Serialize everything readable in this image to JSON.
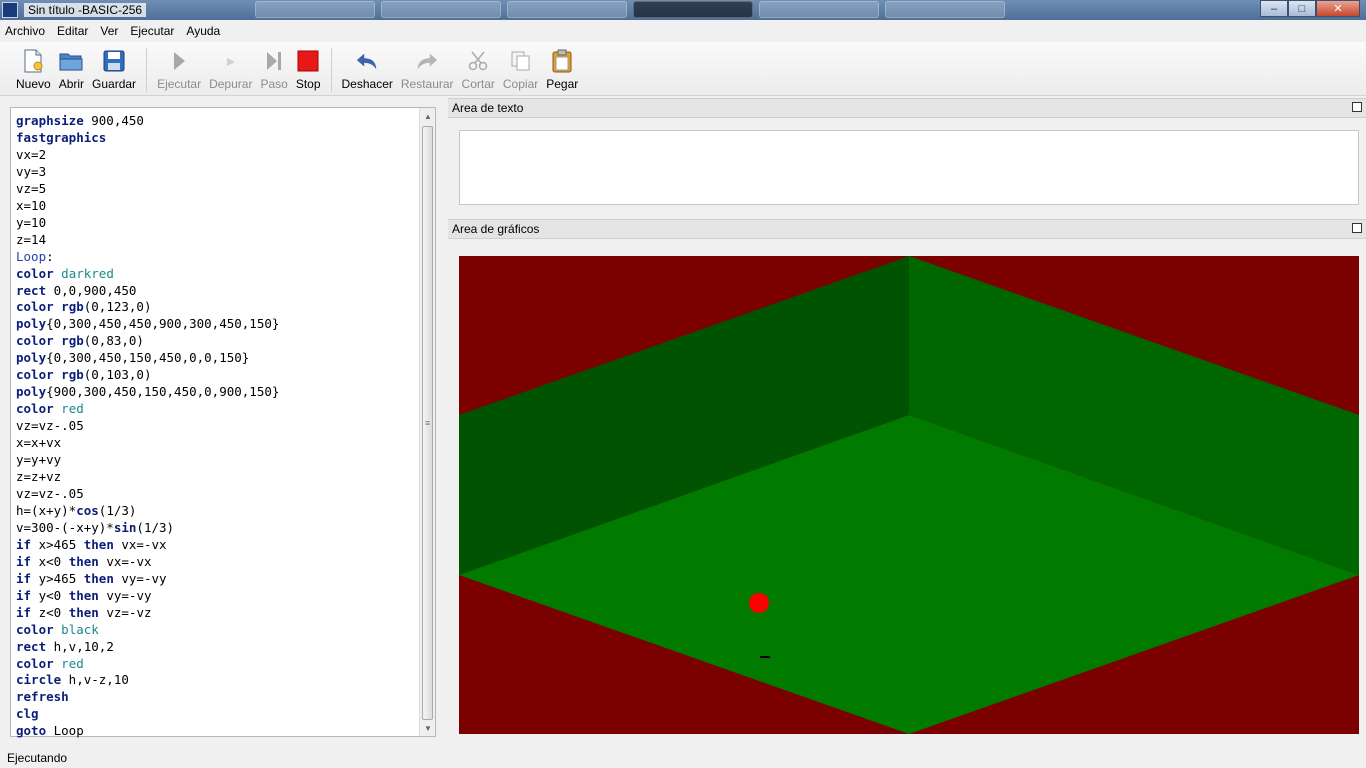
{
  "window": {
    "title": "Sin título -BASIC-256",
    "buttons": {
      "minimize": "–",
      "maximize": "□",
      "close": "✕"
    }
  },
  "menu": {
    "items": [
      "Archivo",
      "Editar",
      "Ver",
      "Ejecutar",
      "Ayuda"
    ]
  },
  "toolbar": {
    "buttons": [
      {
        "label": "Nuevo",
        "icon": "new-file-icon",
        "enabled": true
      },
      {
        "label": "Abrir",
        "icon": "open-folder-icon",
        "enabled": true
      },
      {
        "label": "Guardar",
        "icon": "save-disk-icon",
        "enabled": true
      },
      {
        "label": "Ejecutar",
        "icon": "run-icon",
        "enabled": false
      },
      {
        "label": "Depurar",
        "icon": "debug-icon",
        "enabled": false
      },
      {
        "label": "Paso",
        "icon": "step-icon",
        "enabled": false
      },
      {
        "label": "Stop",
        "icon": "stop-icon",
        "enabled": true
      },
      {
        "label": "Deshacer",
        "icon": "undo-icon",
        "enabled": true
      },
      {
        "label": "Restaurar",
        "icon": "redo-icon",
        "enabled": false
      },
      {
        "label": "Cortar",
        "icon": "scissors-icon",
        "enabled": false
      },
      {
        "label": "Copiar",
        "icon": "copy-icon",
        "enabled": false
      },
      {
        "label": "Pegar",
        "icon": "paste-clipboard-icon",
        "enabled": true
      }
    ]
  },
  "editor": {
    "lines": [
      "graphsize 900,450",
      "fastgraphics",
      "vx=2",
      "vy=3",
      "vz=5",
      "x=10",
      "y=10",
      "z=14",
      "Loop:",
      "color darkred",
      "rect 0,0,900,450",
      "color rgb(0,123,0)",
      "poly{0,300,450,450,900,300,450,150}",
      "color rgb(0,83,0)",
      "poly{0,300,450,150,450,0,0,150}",
      "color rgb(0,103,0)",
      "poly{900,300,450,150,450,0,900,150}",
      "color red",
      "vz=vz-.05",
      "x=x+vx",
      "y=y+vy",
      "z=z+vz",
      "vz=vz-.05",
      "h=(x+y)*cos(1/3)",
      "v=300-(-x+y)*sin(1/3)",
      "if x>465 then vx=-vx",
      "if x<0 then vx=-vx",
      "if y>465 then vy=-vy",
      "if y<0 then vy=-vy",
      "if z<0 then vz=-vz",
      "color black",
      "rect h,v,10,2",
      "color red",
      "circle h,v-z,10",
      "refresh",
      "clg",
      "goto Loop"
    ]
  },
  "panels": {
    "text_title": "Area de texto",
    "graphics_title": "Area de gráficos"
  },
  "graphics_scene": {
    "background": "#7b0000",
    "floor_color": "#007b00",
    "left_wall_color": "#005300",
    "right_wall_color": "#006700",
    "ball_color": "#ff0000",
    "shadow_color": "#000000"
  },
  "status": {
    "text": "Ejecutando"
  }
}
